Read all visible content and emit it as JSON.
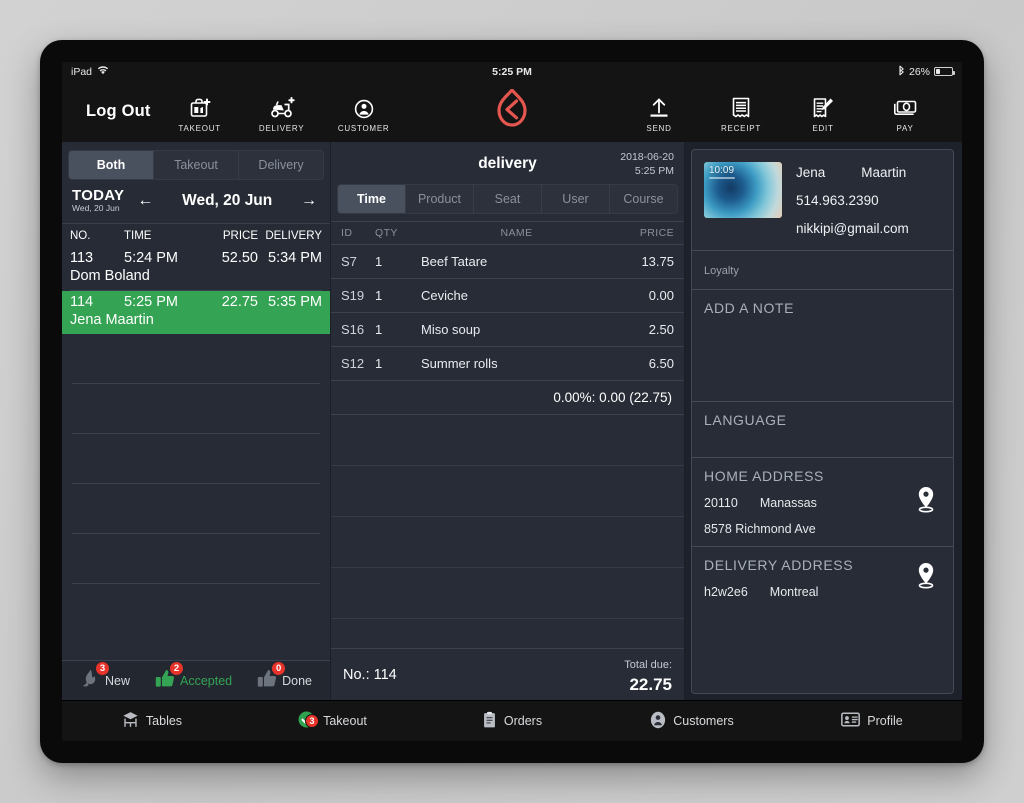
{
  "status_bar": {
    "device": "iPad",
    "wifi_icon": "wifi-icon",
    "time": "5:25 PM",
    "bluetooth_icon": "bluetooth-icon",
    "battery_percent": "26%"
  },
  "toolbar": {
    "logout_label": "Log Out",
    "brand_logo": "lightspeed-flame-logo",
    "brand_color": "#e4564f",
    "items": [
      {
        "label": "TAKEOUT",
        "icon": "takeout-bag-plus-icon"
      },
      {
        "label": "DELIVERY",
        "icon": "scooter-plus-icon"
      },
      {
        "label": "CUSTOMER",
        "icon": "customer-person-icon"
      }
    ],
    "right_items": [
      {
        "label": "SEND",
        "icon": "upload-arrow-icon"
      },
      {
        "label": "RECEIPT",
        "icon": "receipt-icon"
      },
      {
        "label": "EDIT",
        "icon": "receipt-edit-pencil-icon"
      },
      {
        "label": "PAY",
        "icon": "cash-money-icon"
      }
    ]
  },
  "left_panel": {
    "filter_tabs": [
      {
        "label": "Both",
        "active": true
      },
      {
        "label": "Takeout",
        "active": false
      },
      {
        "label": "Delivery",
        "active": false
      }
    ],
    "date_nav": {
      "today_label": "TODAY",
      "today_sub": "Wed, 20 Jun",
      "prev_arrow": "←",
      "current_date": "Wed, 20 Jun",
      "next_arrow": "→"
    },
    "columns": [
      "NO.",
      "TIME",
      "PRICE",
      "DELIVERY"
    ],
    "rows": [
      {
        "no": "113",
        "time": "5:24 PM",
        "price": "52.50",
        "delivery": "5:34 PM",
        "customer": "Dom Boland",
        "selected": false
      },
      {
        "no": "114",
        "time": "5:25 PM",
        "price": "22.75",
        "delivery": "5:35 PM",
        "customer": "Jena Maartin",
        "selected": true
      }
    ],
    "selected_color": "#34a353",
    "empty_row_count": 5,
    "status_footer": [
      {
        "label": "New",
        "count": "3",
        "icon": "flame-icon",
        "highlight": false
      },
      {
        "label": "Accepted",
        "count": "2",
        "icon": "thumbs-up-icon",
        "highlight": true
      },
      {
        "label": "Done",
        "count": "0",
        "icon": "thumbs-up-filled-icon",
        "highlight": false
      }
    ],
    "badge_color": "#e8332a"
  },
  "center_panel": {
    "title": "delivery",
    "date": "2018-06-20",
    "time": "5:25 PM",
    "sort_tabs": [
      {
        "label": "Time",
        "active": true
      },
      {
        "label": "Product",
        "active": false
      },
      {
        "label": "Seat",
        "active": false
      },
      {
        "label": "User",
        "active": false
      },
      {
        "label": "Course",
        "active": false
      }
    ],
    "columns": [
      "ID",
      "QTY",
      "NAME",
      "PRICE"
    ],
    "items": [
      {
        "id": "S7",
        "qty": "1",
        "name": "Beef Tatare",
        "price": "13.75"
      },
      {
        "id": "S19",
        "qty": "1",
        "name": "Ceviche",
        "price": "0.00"
      },
      {
        "id": "S16",
        "qty": "1",
        "name": "Miso soup",
        "price": "2.50"
      },
      {
        "id": "S12",
        "qty": "1",
        "name": "Summer rolls",
        "price": "6.50"
      }
    ],
    "tax_line": "0.00%: 0.00 (22.75)",
    "empty_row_count": 4,
    "footer": {
      "order_no": "No.: 114",
      "total_due_label": "Total due:",
      "total_due_amount": "22.75"
    }
  },
  "right_panel": {
    "customer": {
      "avatar_icon": "customer-photo-ipad-wallpaper",
      "avatar_time": "10:09",
      "first_name": "Jena",
      "last_name": "Maartin",
      "phone": "514.963.2390",
      "email": "nikkipi@gmail.com"
    },
    "loyalty_label": "Loyalty",
    "note_label": "ADD A NOTE",
    "language_label": "LANGUAGE",
    "home_address": {
      "title": "HOME ADDRESS",
      "zip": "20110",
      "city": "Manassas",
      "street": "8578 Richmond Ave",
      "pin_icon": "map-pin-icon"
    },
    "delivery_address": {
      "title": "DELIVERY ADDRESS",
      "zip": "h2w2e6",
      "city": "Montreal",
      "pin_icon": "map-pin-icon"
    }
  },
  "tab_bar": [
    {
      "label": "Tables",
      "icon": "tables-icon",
      "badge": null,
      "active": false
    },
    {
      "label": "Takeout",
      "icon": "takeout-check-icon",
      "badge": "3",
      "active": true
    },
    {
      "label": "Orders",
      "icon": "orders-clipboard-icon",
      "badge": null,
      "active": false
    },
    {
      "label": "Customers",
      "icon": "customers-person-icon",
      "badge": null,
      "active": false
    },
    {
      "label": "Profile",
      "icon": "profile-card-icon",
      "badge": null,
      "active": false
    }
  ]
}
